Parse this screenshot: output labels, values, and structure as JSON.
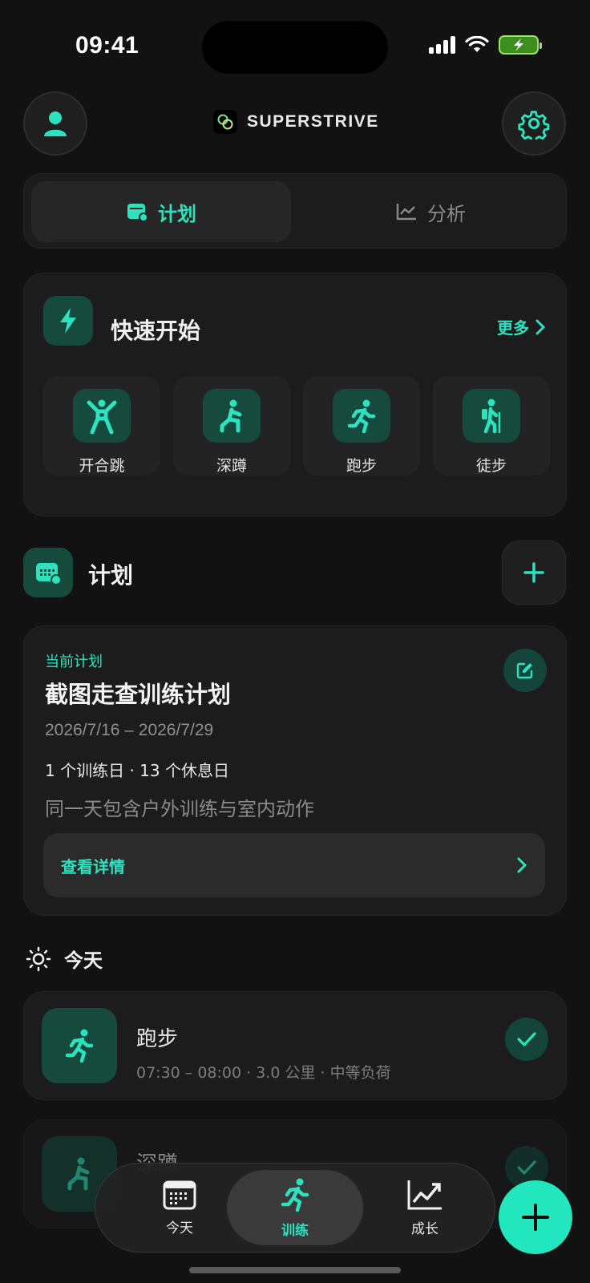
{
  "status": {
    "time": "09:41"
  },
  "header": {
    "brand": "SUPERSTRIVE"
  },
  "segments": {
    "plan": "计划",
    "analysis": "分析"
  },
  "quick_start": {
    "title": "快速开始",
    "more": "更多",
    "items": [
      {
        "label": "开合跳",
        "icon": "jumping-jack-icon"
      },
      {
        "label": "深蹲",
        "icon": "squat-icon"
      },
      {
        "label": "跑步",
        "icon": "running-icon"
      },
      {
        "label": "徒步",
        "icon": "hiking-icon"
      }
    ]
  },
  "plan_section": {
    "title": "计划"
  },
  "plan_card": {
    "caption": "当前计划",
    "name": "截图走查训练计划",
    "dates": "2026/7/16 – 2026/7/29",
    "days": "1 个训练日 · 13 个休息日",
    "description": "同一天包含户外训练与室内动作",
    "detail_link": "查看详情"
  },
  "today": {
    "title": "今天",
    "activities": [
      {
        "name": "跑步",
        "meta": "07:30 – 08:00 · 3.0 公里 · 中等负荷"
      },
      {
        "name": "深蹲",
        "meta": ""
      }
    ]
  },
  "nav": {
    "today": "今天",
    "train": "训练",
    "grow": "成长"
  },
  "colors": {
    "accent": "#2de3bf",
    "tile": "#154a3d",
    "background": "#121212",
    "card": "#1c1c1c"
  }
}
